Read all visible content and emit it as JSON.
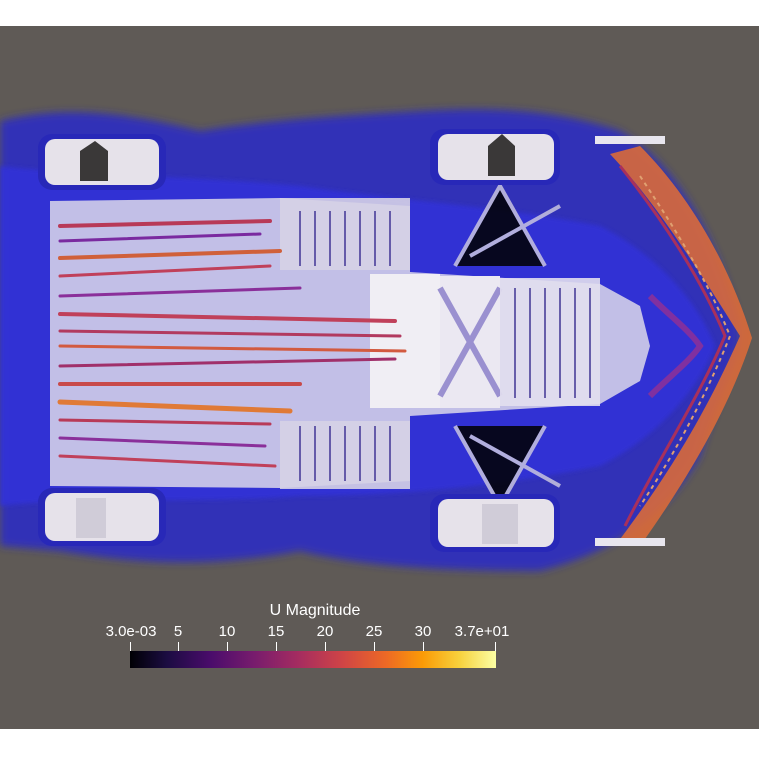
{
  "legend": {
    "title": "U Magnitude",
    "ticks": [
      "3.0e-03",
      "5",
      "10",
      "15",
      "20",
      "25",
      "30",
      "3.7e+01"
    ],
    "range": [
      0.003,
      37
    ],
    "colormap": "inferno"
  },
  "colors": {
    "background": "#5f5a56",
    "car_body": "#e8e6ee",
    "flow_blue": "#2a2ad6",
    "flow_purple": "#6a2a9a",
    "flow_red": "#c83c4a",
    "flow_orange": "#e07a3a"
  }
}
